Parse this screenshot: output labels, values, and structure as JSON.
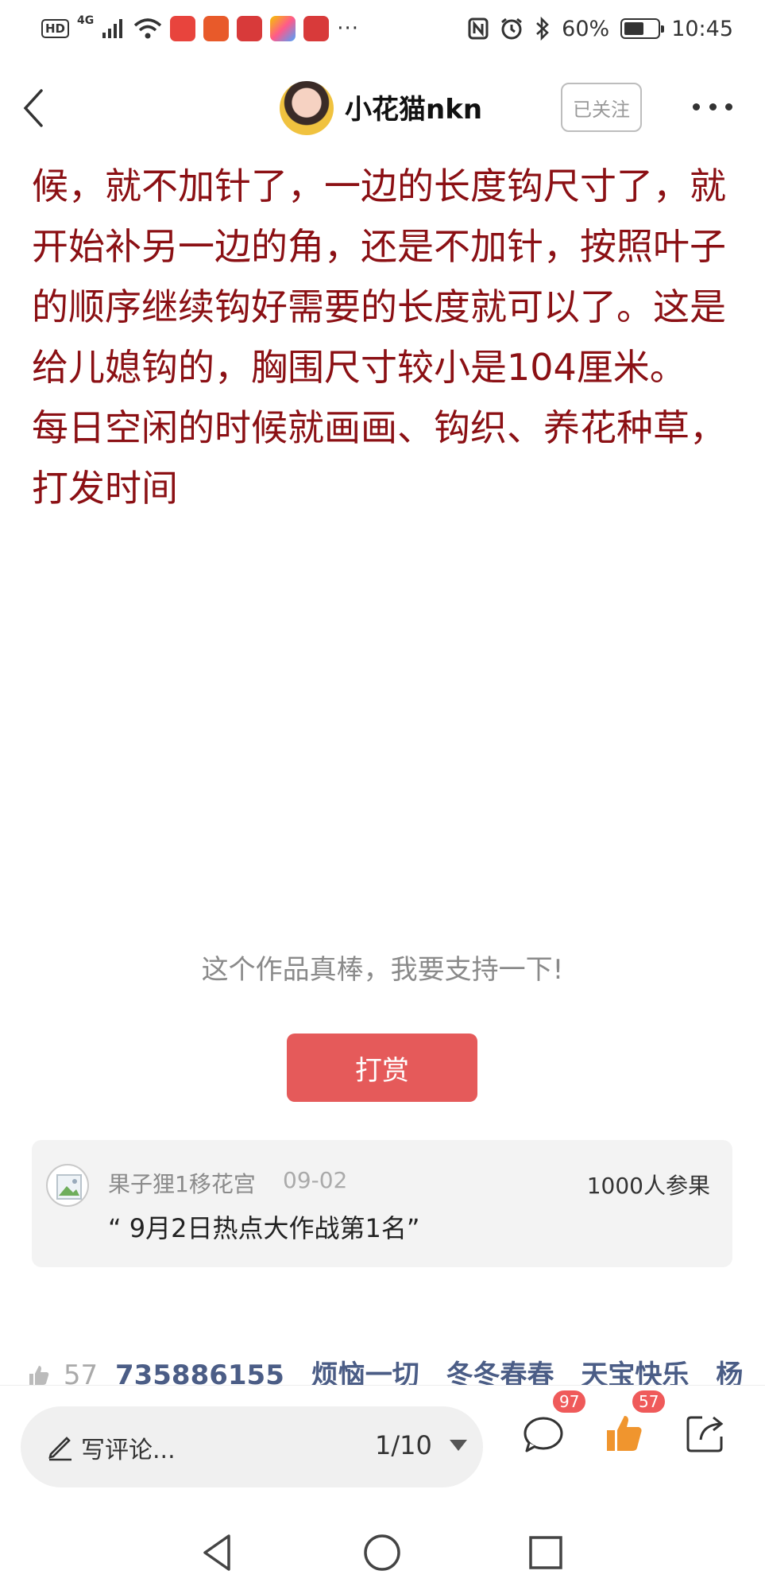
{
  "status_bar": {
    "hd": "HD",
    "network": "4G",
    "more": "···",
    "battery": "60%",
    "battery_level": 0.6,
    "time": "10:45"
  },
  "header": {
    "username": "小花猫nkn",
    "follow_label": "已关注"
  },
  "article": {
    "paragraphs": [
      "候，就不加针了，一边的长度钩尺寸了，就开始补另一边的角，还是不加针，按照叶子的顺序继续钩好需要的长度就可以了。这是给儿媳钩的，胸围尺寸较小是104厘米。",
      "每日空闲的时候就画画、钩织、养花种草，打发时间"
    ]
  },
  "reward": {
    "prompt": "这个作品真棒，我要支持一下!",
    "button_label": "打赏"
  },
  "activity_card": {
    "name": "果子狸1移花宫",
    "date": "09-02",
    "participants": "1000人参果",
    "quote": "“ 9月2日热点大作战第1名”"
  },
  "likes": {
    "count": "57",
    "names": [
      "735886155",
      "烦恼一切",
      "冬冬春春",
      "天宝快乐",
      "杨"
    ]
  },
  "bottom_bar": {
    "comment_placeholder": "写评论...",
    "page_indicator": "1/10",
    "comment_badge": "97",
    "like_badge": "57"
  },
  "colors": {
    "article_text": "#8b1014",
    "reward_button": "#e55a5a",
    "badge": "#ef5a5a",
    "like_icon": "#f0952e",
    "likes_names": "#4b5d86"
  }
}
